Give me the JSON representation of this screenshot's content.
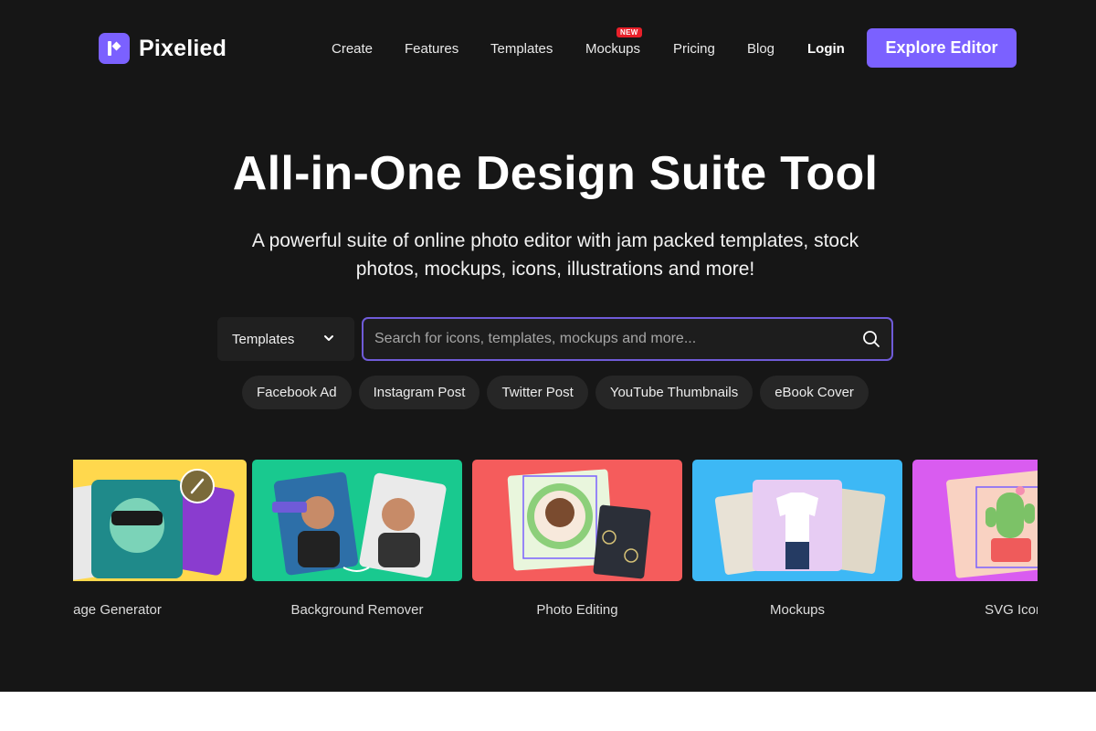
{
  "brand": {
    "name": "Pixelied",
    "accent": "#7b61ff"
  },
  "nav": {
    "items": [
      {
        "label": "Create"
      },
      {
        "label": "Features"
      },
      {
        "label": "Templates"
      },
      {
        "label": "Mockups",
        "badge": "NEW"
      },
      {
        "label": "Pricing"
      },
      {
        "label": "Blog"
      }
    ],
    "login": "Login",
    "cta": "Explore Editor"
  },
  "hero": {
    "title": "All-in-One Design Suite Tool",
    "subtitle": "A powerful suite of online photo editor with jam packed templates, stock photos, mockups, icons, illustrations and more!"
  },
  "search": {
    "category": "Templates",
    "placeholder": "Search for icons, templates, mockups and more...",
    "icon": "search-icon"
  },
  "chips": [
    "Facebook Ad",
    "Instagram Post",
    "Twitter Post",
    "YouTube Thumbnails",
    "eBook Cover"
  ],
  "cards": [
    {
      "label": "AI Image Generator",
      "color": "#ffd84d"
    },
    {
      "label": "Background Remover",
      "color": "#19c98f"
    },
    {
      "label": "Photo Editing",
      "color": "#f55c5c"
    },
    {
      "label": "Mockups",
      "color": "#3db8f5"
    },
    {
      "label": "SVG Icons",
      "color": "#d95cf0"
    }
  ]
}
